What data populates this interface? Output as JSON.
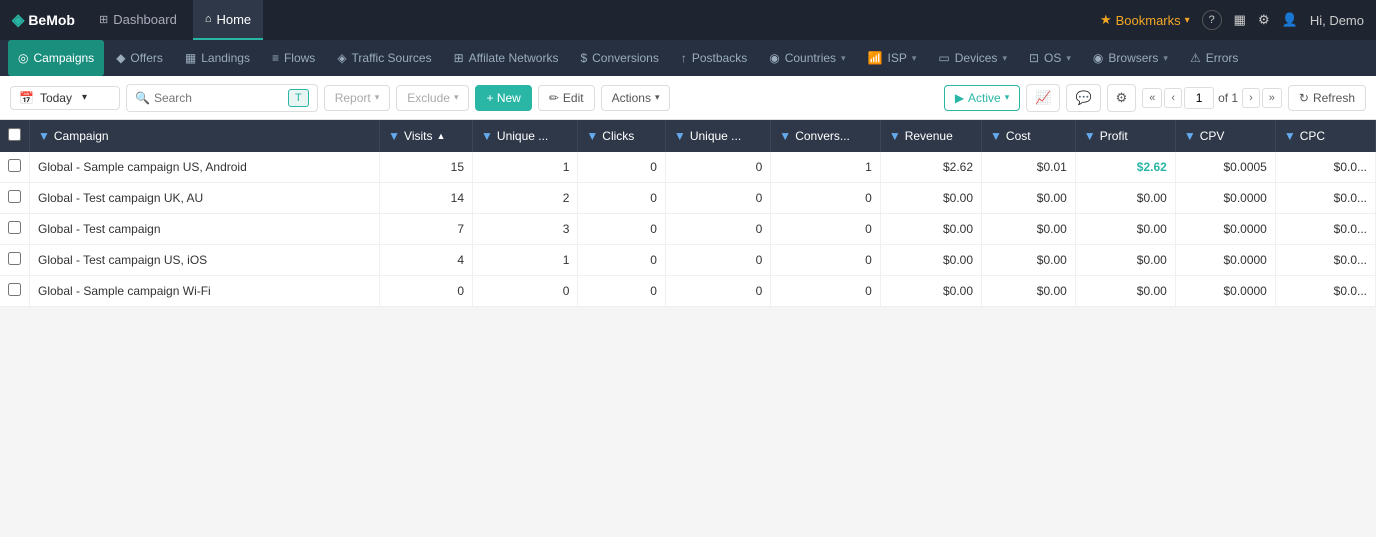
{
  "app": {
    "logo": "BeMob",
    "logo_icon": "◈"
  },
  "top_nav": {
    "tabs": [
      {
        "id": "dashboard",
        "label": "Dashboard",
        "icon": "⊞",
        "active": false
      },
      {
        "id": "home",
        "label": "Home",
        "icon": "⌂",
        "active": true
      }
    ],
    "right": {
      "bookmarks_label": "Bookmarks",
      "help_icon": "?",
      "notifications_icon": "▦",
      "settings_icon": "⚙",
      "user_label": "Hi, Demo"
    }
  },
  "sub_nav": {
    "items": [
      {
        "id": "campaigns",
        "label": "Campaigns",
        "icon": "◎",
        "active": true,
        "has_chevron": false
      },
      {
        "id": "offers",
        "label": "Offers",
        "icon": "◆",
        "active": false,
        "has_chevron": false
      },
      {
        "id": "landings",
        "label": "Landings",
        "icon": "▦",
        "active": false,
        "has_chevron": false
      },
      {
        "id": "flows",
        "label": "Flows",
        "icon": "≡",
        "active": false,
        "has_chevron": false
      },
      {
        "id": "traffic-sources",
        "label": "Traffic Sources",
        "icon": "◈",
        "active": false,
        "has_chevron": false
      },
      {
        "id": "affiliate-networks",
        "label": "Affilate Networks",
        "icon": "⊞",
        "active": false,
        "has_chevron": false
      },
      {
        "id": "conversions",
        "label": "Conversions",
        "icon": "$",
        "active": false,
        "has_chevron": false
      },
      {
        "id": "postbacks",
        "label": "Postbacks",
        "icon": "↑",
        "active": false,
        "has_chevron": false
      },
      {
        "id": "countries",
        "label": "Countries",
        "icon": "◉",
        "active": false,
        "has_chevron": true
      },
      {
        "id": "isp",
        "label": "ISP",
        "icon": "wireless",
        "active": false,
        "has_chevron": true
      },
      {
        "id": "devices",
        "label": "Devices",
        "icon": "▭",
        "active": false,
        "has_chevron": true
      },
      {
        "id": "os",
        "label": "OS",
        "icon": "⊡",
        "active": false,
        "has_chevron": true
      },
      {
        "id": "browsers",
        "label": "Browsers",
        "icon": "▦",
        "active": false,
        "has_chevron": true
      },
      {
        "id": "errors",
        "label": "Errors",
        "icon": "⚠",
        "active": false,
        "has_chevron": false
      }
    ]
  },
  "toolbar": {
    "date_label": "Today",
    "date_icon": "📅",
    "search_placeholder": "Search",
    "filter_tag": "T",
    "report_label": "Report",
    "exclude_label": "Exclude",
    "new_label": "+ New",
    "edit_label": "Edit",
    "actions_label": "Actions",
    "active_label": "Active",
    "chart_icon": "📈",
    "comment_icon": "💬",
    "settings_icon": "⚙",
    "page_current": "1",
    "page_of": "of 1",
    "refresh_label": "Refresh"
  },
  "table": {
    "columns": [
      {
        "id": "checkbox",
        "label": ""
      },
      {
        "id": "campaign",
        "label": "Campaign"
      },
      {
        "id": "visits",
        "label": "Visits"
      },
      {
        "id": "unique1",
        "label": "Unique ..."
      },
      {
        "id": "clicks",
        "label": "Clicks"
      },
      {
        "id": "unique2",
        "label": "Unique ..."
      },
      {
        "id": "conversions",
        "label": "Convers..."
      },
      {
        "id": "revenue",
        "label": "Revenue"
      },
      {
        "id": "cost",
        "label": "Cost"
      },
      {
        "id": "profit",
        "label": "Profit"
      },
      {
        "id": "cpv",
        "label": "CPV"
      },
      {
        "id": "cpc",
        "label": "CPC"
      }
    ],
    "rows": [
      {
        "campaign": "Global - Sample campaign US, Android",
        "visits": "15",
        "unique1": "1",
        "clicks": "0",
        "unique2": "0",
        "conversions": "1",
        "revenue": "$2.62",
        "cost": "$0.01",
        "profit": "$2.62",
        "profit_positive": true,
        "cpv": "$0.0005",
        "cpc": "$0.0..."
      },
      {
        "campaign": "Global - Test campaign UK, AU",
        "visits": "14",
        "unique1": "2",
        "clicks": "0",
        "unique2": "0",
        "conversions": "0",
        "revenue": "$0.00",
        "cost": "$0.00",
        "profit": "$0.00",
        "profit_positive": false,
        "cpv": "$0.0000",
        "cpc": "$0.0..."
      },
      {
        "campaign": "Global - Test campaign",
        "visits": "7",
        "unique1": "3",
        "clicks": "0",
        "unique2": "0",
        "conversions": "0",
        "revenue": "$0.00",
        "cost": "$0.00",
        "profit": "$0.00",
        "profit_positive": false,
        "cpv": "$0.0000",
        "cpc": "$0.0..."
      },
      {
        "campaign": "Global - Test campaign US, iOS",
        "visits": "4",
        "unique1": "1",
        "clicks": "0",
        "unique2": "0",
        "conversions": "0",
        "revenue": "$0.00",
        "cost": "$0.00",
        "profit": "$0.00",
        "profit_positive": false,
        "cpv": "$0.0000",
        "cpc": "$0.0..."
      },
      {
        "campaign": "Global - Sample campaign Wi-Fi",
        "visits": "0",
        "unique1": "0",
        "clicks": "0",
        "unique2": "0",
        "conversions": "0",
        "revenue": "$0.00",
        "cost": "$0.00",
        "profit": "$0.00",
        "profit_positive": false,
        "cpv": "$0.0000",
        "cpc": "$0.0..."
      }
    ]
  }
}
